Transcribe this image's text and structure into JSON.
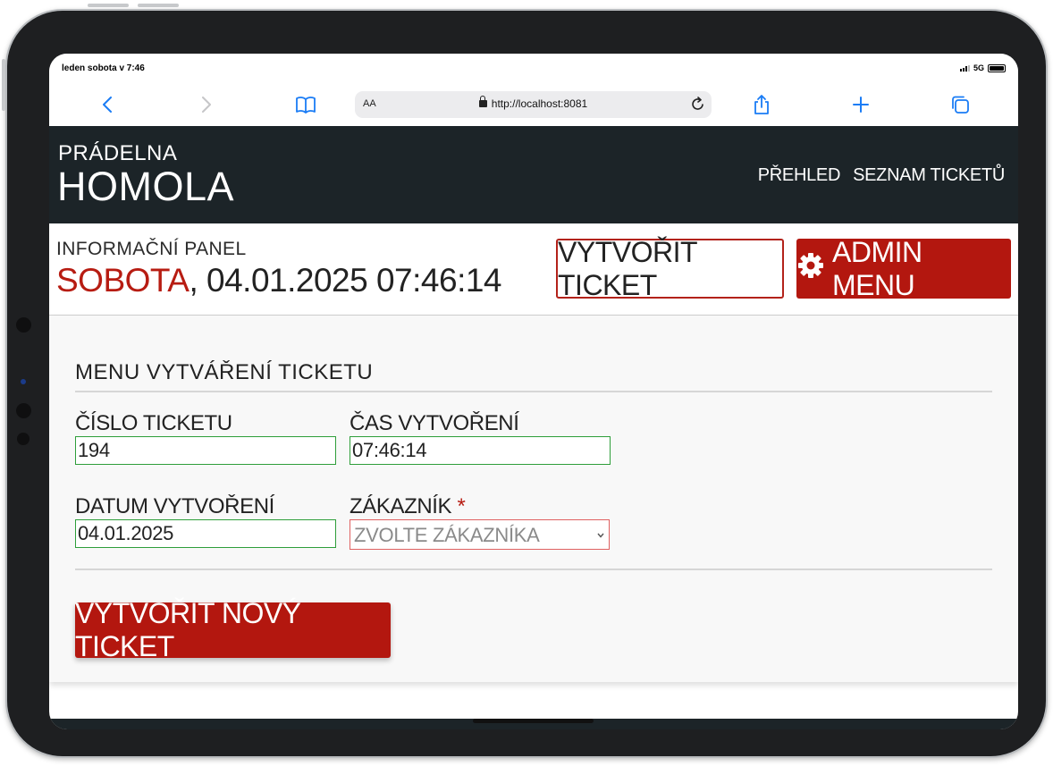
{
  "statusbar": {
    "time": "leden sobota v 7:46",
    "network": "5G"
  },
  "browser": {
    "aa_label": "AA",
    "url": "http://localhost:8081"
  },
  "site": {
    "brand_top": "PRÁDELNA",
    "brand_main": "HOMOLA",
    "nav": {
      "overview": "PŘEHLED",
      "tickets": "SEZNAM TICKETŮ"
    }
  },
  "info_panel": {
    "label": "INFORMAČNÍ PANEL",
    "day": "SOBOTA",
    "datetime": ", 04.01.2025 07:46:14",
    "create_ticket_label": "VYTVOŘIT TICKET",
    "admin_menu_label": "ADMIN MENU"
  },
  "form": {
    "title": "MENU VYTVÁŘENÍ TICKETU",
    "ticket_number": {
      "label": "ČÍSLO TICKETU",
      "value": "194"
    },
    "created_time": {
      "label": "ČAS VYTVOŘENÍ",
      "value": "07:46:14"
    },
    "created_date": {
      "label": "DATUM VYTVOŘENÍ",
      "value": "04.01.2025"
    },
    "customer": {
      "label": "ZÁKAZNÍK",
      "required_mark": "*",
      "placeholder": "ZVOLTE ZÁKAZNÍKA"
    },
    "submit_label": "VYTVOŘIT NOVÝ TICKET"
  },
  "colors": {
    "accent": "#b3170f",
    "header_bg": "#1c2428",
    "valid_border": "#2e9e3a",
    "invalid_border": "#e06161"
  }
}
